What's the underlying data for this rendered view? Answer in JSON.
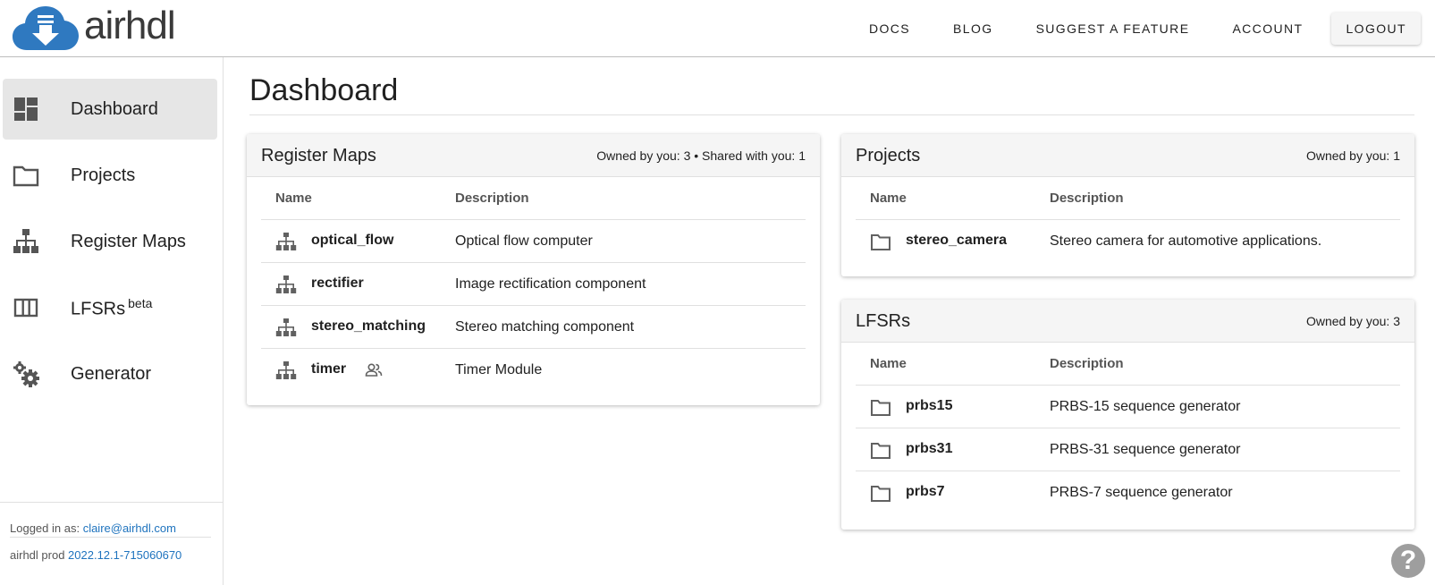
{
  "brand": {
    "name": "airhdl"
  },
  "topnav": {
    "docs": "DOCS",
    "blog": "BLOG",
    "suggest": "SUGGEST A FEATURE",
    "account": "ACCOUNT",
    "logout": "LOGOUT"
  },
  "sidebar": {
    "items": [
      {
        "label": "Dashboard",
        "icon": "dashboard-icon",
        "active": true
      },
      {
        "label": "Projects",
        "icon": "folder-icon"
      },
      {
        "label": "Register Maps",
        "icon": "hierarchy-icon"
      },
      {
        "label": "LFSRs",
        "badge": "beta",
        "icon": "columns-icon"
      },
      {
        "label": "Generator",
        "icon": "gears-icon"
      }
    ],
    "footer": {
      "logged_in_label": "Logged in as: ",
      "user_email": "claire@airhdl.com",
      "env_label": "airhdl prod ",
      "version": "2022.12.1-715060670"
    }
  },
  "main": {
    "title": "Dashboard"
  },
  "register_maps": {
    "title": "Register Maps",
    "meta": "Owned by you: 3 • Shared with you: 1",
    "col_name": "Name",
    "col_desc": "Description",
    "rows": [
      {
        "name": "optical_flow",
        "desc": "Optical flow computer"
      },
      {
        "name": "rectifier",
        "desc": "Image rectification component"
      },
      {
        "name": "stereo_matching",
        "desc": "Stereo matching component"
      },
      {
        "name": "timer",
        "desc": "Timer Module",
        "shared": true
      }
    ]
  },
  "projects": {
    "title": "Projects",
    "meta": "Owned by you: 1",
    "col_name": "Name",
    "col_desc": "Description",
    "rows": [
      {
        "name": "stereo_camera",
        "desc": "Stereo camera for automotive applications."
      }
    ]
  },
  "lfsrs": {
    "title": "LFSRs",
    "meta": "Owned by you: 3",
    "col_name": "Name",
    "col_desc": "Description",
    "rows": [
      {
        "name": "prbs15",
        "desc": "PRBS-15 sequence generator"
      },
      {
        "name": "prbs31",
        "desc": "PRBS-31 sequence generator"
      },
      {
        "name": "prbs7",
        "desc": "PRBS-7 sequence generator"
      }
    ]
  },
  "help": {
    "label": "?"
  },
  "colors": {
    "brand_blue": "#2f79c0",
    "link": "#1e73be",
    "icon_gray": "#616161"
  }
}
